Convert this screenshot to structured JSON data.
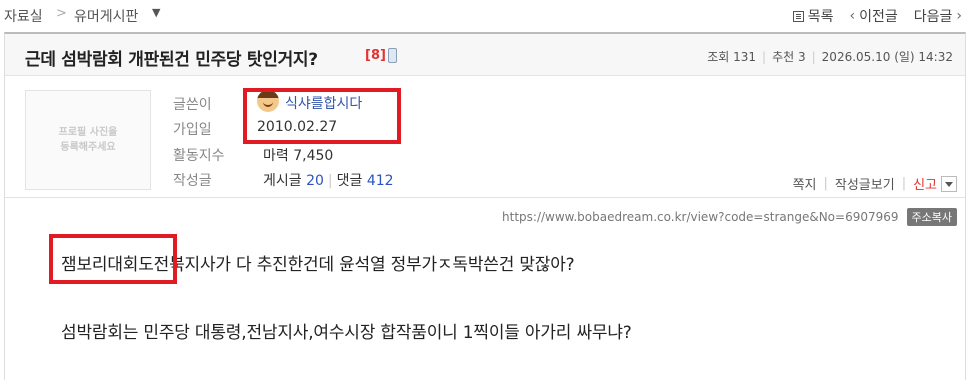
{
  "breadcrumb": {
    "home": "자료실",
    "separator": ">",
    "board": "유머게시판"
  },
  "nav": {
    "list": "목록",
    "prev": "이전글",
    "next": "다음글"
  },
  "post": {
    "title": "근데 섬박람회 개판된건 민주당 탓인거지?",
    "comment_count": "[8]",
    "meta": {
      "views_label": "조회",
      "views": "131",
      "recommend_label": "추천",
      "recommend": "3",
      "datetime": "2026.05.10 (일) 14:32"
    },
    "author": {
      "photo_placeholder_line1": "프로필 사진을",
      "photo_placeholder_line2": "등록해주세요",
      "writer_label": "글쓴이",
      "nickname": "식샤를합시다",
      "joined_label": "가입일",
      "joined": "2010.02.27",
      "activity_label": "활동지수",
      "activity": "마력 7,450",
      "posts_label": "작성글",
      "posts_text": "게시글",
      "posts_count": "20",
      "comments_text": "댓글",
      "comments_count": "412"
    },
    "actions": {
      "message": "쪽지",
      "view_posts": "작성글보기",
      "report": "신고"
    },
    "url": "https://www.bobaedream.co.kr/view?code=strange&No=6907969",
    "copy_label": "주소복사",
    "body": {
      "line1_highlight": "잼보리대회도",
      "line1_rest": "전북지사가 다 추진한건데 윤석열 정부가ㅈ독박쓴건 맞잖아?",
      "line2": "섬박람회는 민주당 대통령,전남지사,여수시장 합작품이니 1찍이들 아가리 싸무냐?"
    }
  },
  "colors": {
    "highlight_box": "#e01b24",
    "link_blue": "#2b54c2",
    "report_red": "#e23333"
  }
}
